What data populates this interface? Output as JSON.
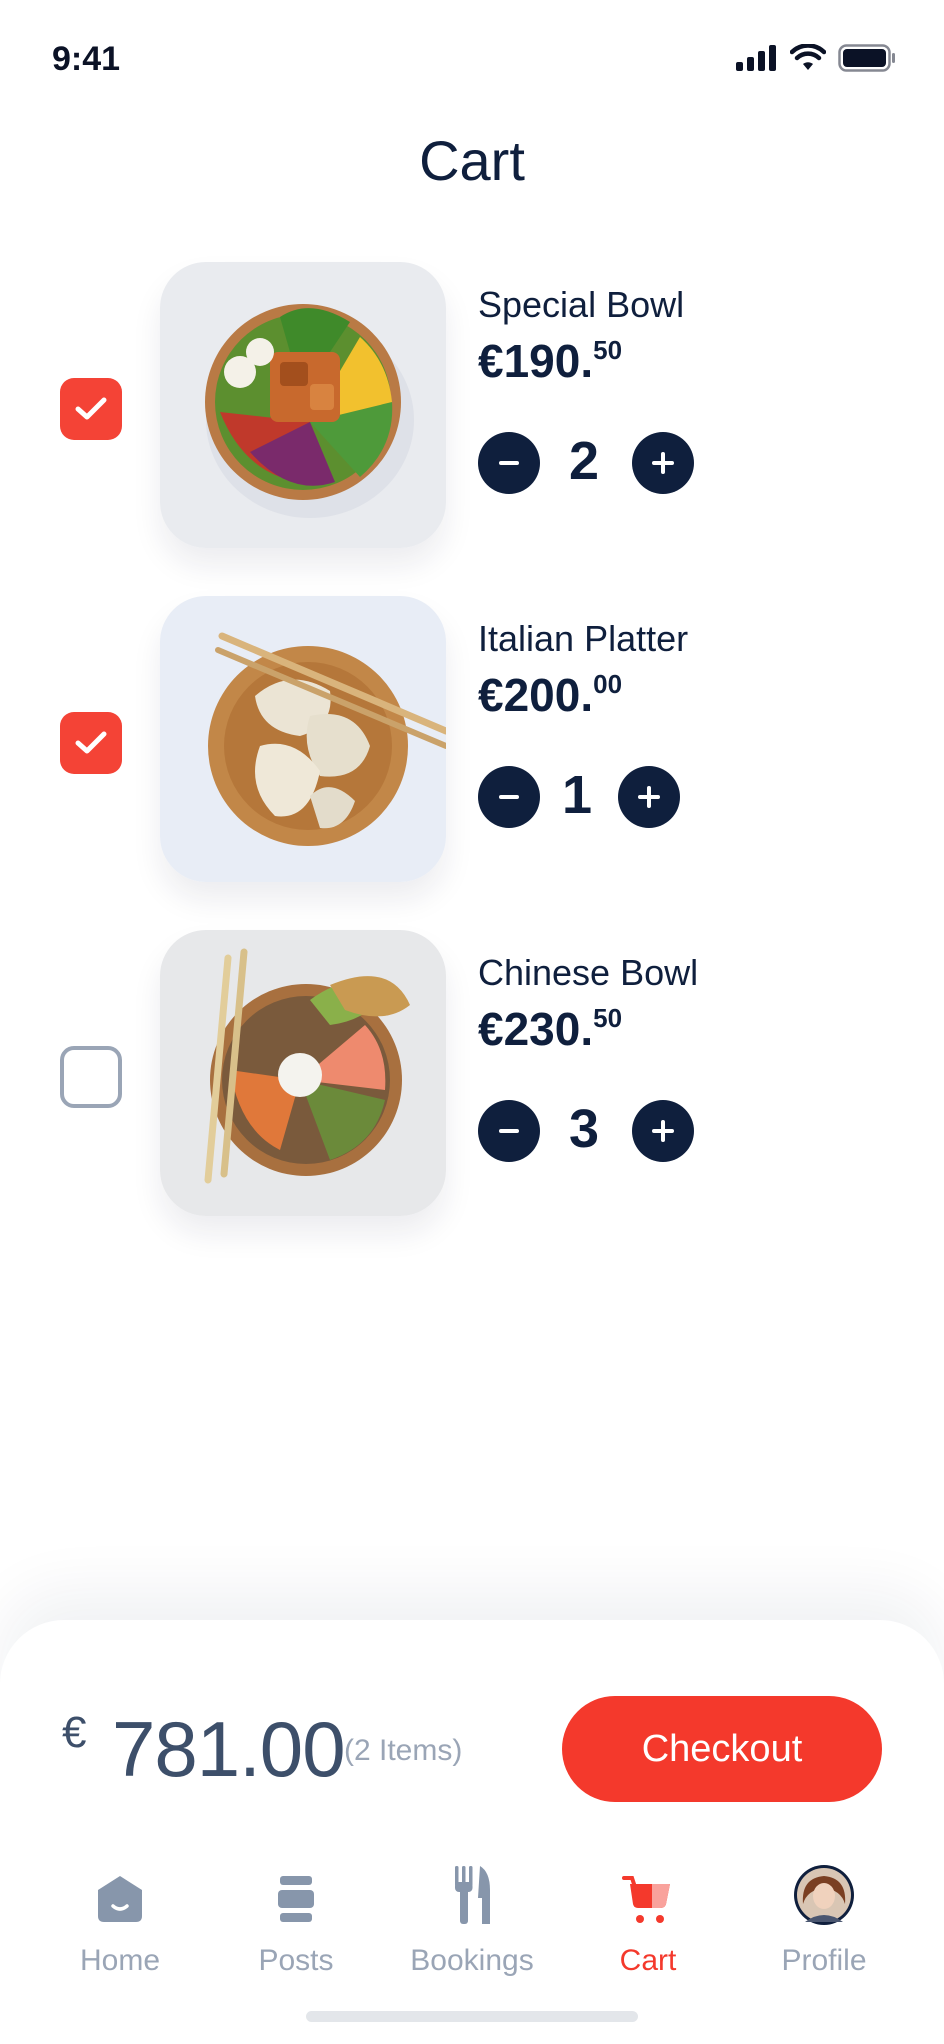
{
  "status_bar": {
    "time": "9:41",
    "icons": [
      "signal-icon",
      "wifi-icon",
      "battery-icon"
    ]
  },
  "header": {
    "title": "Cart"
  },
  "cart": {
    "items": [
      {
        "name": "Special Bowl",
        "price_main": "€190.",
        "price_cents": "50",
        "quantity": "2",
        "checked": true,
        "image": "salad-bowl-image"
      },
      {
        "name": "Italian Platter",
        "price_main": "€200.",
        "price_cents": "00",
        "quantity": "1",
        "checked": true,
        "image": "dumplings-image"
      },
      {
        "name": "Chinese Bowl",
        "price_main": "€230.",
        "price_cents": "50",
        "quantity": "3",
        "checked": false,
        "image": "noodle-bowl-image"
      }
    ]
  },
  "summary": {
    "currency": "€",
    "total": "781.00",
    "item_count": "(2 Items)",
    "checkout_label": "Checkout"
  },
  "tab_bar": {
    "tabs": [
      {
        "label": "Home",
        "icon": "home-icon",
        "active": false
      },
      {
        "label": "Posts",
        "icon": "posts-icon",
        "active": false
      },
      {
        "label": "Bookings",
        "icon": "cutlery-icon",
        "active": false
      },
      {
        "label": "Cart",
        "icon": "cart-icon",
        "active": true
      },
      {
        "label": "Profile",
        "icon": "avatar",
        "active": false
      }
    ]
  },
  "colors": {
    "accent": "#f4392c",
    "navy": "#0f1f3d",
    "muted": "#9aa5b6"
  }
}
